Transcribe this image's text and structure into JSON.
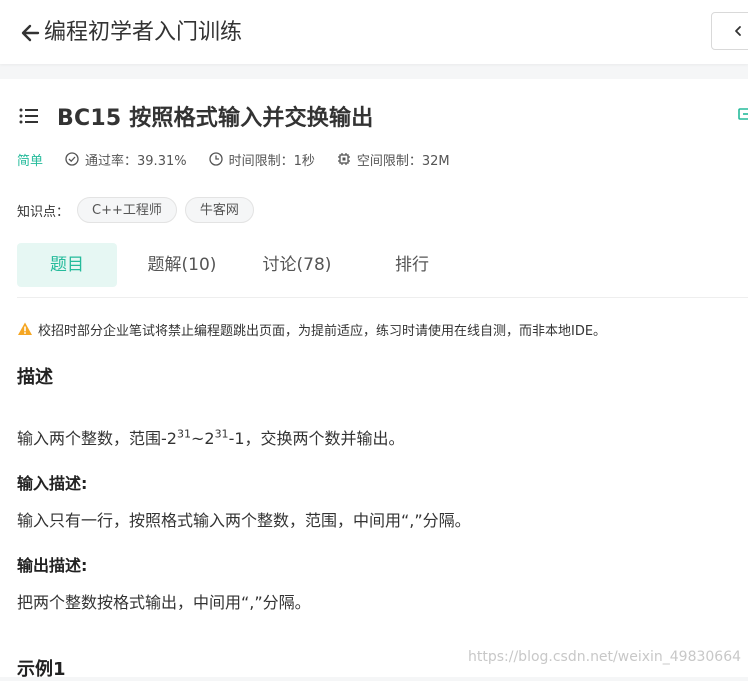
{
  "header": {
    "back_icon": "arrow-left-icon",
    "title": "编程初学者入门训练",
    "right_icon": "chevron-left-icon"
  },
  "problem": {
    "list_icon": "list-icon",
    "title": "BC15  按照格式输入并交换输出",
    "difficulty": "简单",
    "pass_rate": "通过率：39.31%",
    "time_limit": "时间限制：1秒",
    "space_limit": "空间限制：32M",
    "tags_label": "知识点：",
    "tags": [
      "C++工程师",
      "牛客网"
    ]
  },
  "tabs": [
    {
      "label": "题目",
      "active": true
    },
    {
      "label": "题解(10)",
      "active": false
    },
    {
      "label": "讨论(78)",
      "active": false
    },
    {
      "label": "排行",
      "active": false
    }
  ],
  "notice": "校招时部分企业笔试将禁止编程题跳出页面，为提前适应，练习时请使用在线自测，而非本地IDE。",
  "description": {
    "title": "描述",
    "text_pre": "输入两个整数，范围-2",
    "exp1": "31",
    "text_mid": "~2",
    "exp2": "31",
    "text_post": "-1，交换两个数并输出。"
  },
  "input_desc": {
    "title": "输入描述:",
    "text": "输入只有一行，按照格式输入两个整数，范围，中间用“,”分隔。"
  },
  "output_desc": {
    "title": "输出描述:",
    "text": "把两个整数按格式输出，中间用“,”分隔。"
  },
  "example": {
    "title": "示例1"
  },
  "watermark": "https://blog.csdn.net/weixin_49830664",
  "colors": {
    "accent": "#25bb9b",
    "warning": "#f5a623",
    "background": "#f5f6f7"
  }
}
